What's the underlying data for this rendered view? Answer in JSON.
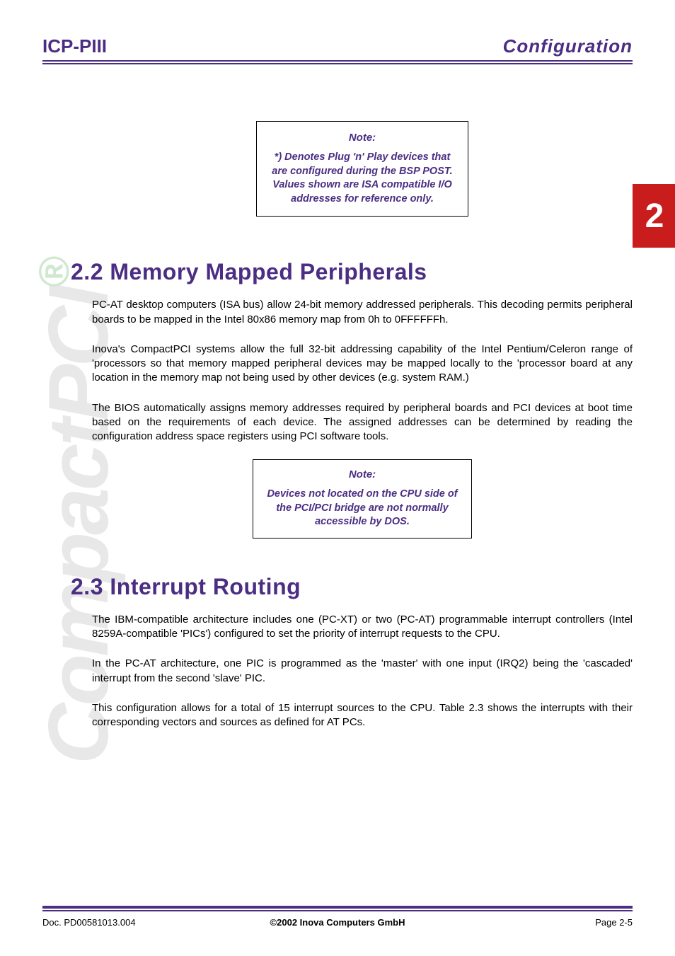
{
  "header": {
    "left": "ICP-PIII",
    "right": "Configuration"
  },
  "sidebar": {
    "text": "CompactPCI",
    "reg": "®"
  },
  "chapter_tab": "2",
  "note1": {
    "title": "Note:",
    "body": "*) Denotes Plug 'n' Play devices that are configured during the BSP POST. Values shown are ISA compatible I/O addresses for reference only."
  },
  "section22": {
    "heading": "2.2 Memory Mapped Peripherals",
    "p1": "PC-AT desktop computers (ISA bus) allow 24-bit memory addressed peripherals. This decoding permits peripheral boards to be mapped in the Intel 80x86 memory map from 0h to 0FFFFFFh.",
    "p2": "Inova's CompactPCI systems allow the full 32-bit addressing capability of the Intel Pentium/Celeron range of 'processors so that memory mapped peripheral devices may be mapped locally to the 'processor board at any location in the memory map not being used by other devices (e.g. system RAM.)",
    "p3": "The BIOS automatically assigns memory addresses required by peripheral boards and PCI devices at boot time based on the requirements of each device. The assigned addresses can be determined by reading the configuration address space registers using PCI software tools."
  },
  "note2": {
    "title": "Note:",
    "body": "Devices not located on the CPU side of the PCI/PCI bridge are not normally accessible by DOS."
  },
  "section23": {
    "heading": "2.3 Interrupt Routing",
    "p1": "The IBM-compatible architecture includes one (PC-XT) or two (PC-AT) programmable interrupt controllers (Intel 8259A-compatible 'PICs') configured to set the priority of interrupt requests to the CPU.",
    "p2": "In the PC-AT architecture, one PIC is programmed as the 'master' with one input (IRQ2) being the 'cascaded' interrupt from the second 'slave' PIC.",
    "p3": "This configuration allows for a total of 15 interrupt sources to the CPU. Table 2.3 shows the interrupts with their corresponding vectors and sources as defined for AT PCs."
  },
  "footer": {
    "left": "Doc. PD00581013.004",
    "center": "©2002 Inova Computers GmbH",
    "right": "Page 2-5"
  }
}
